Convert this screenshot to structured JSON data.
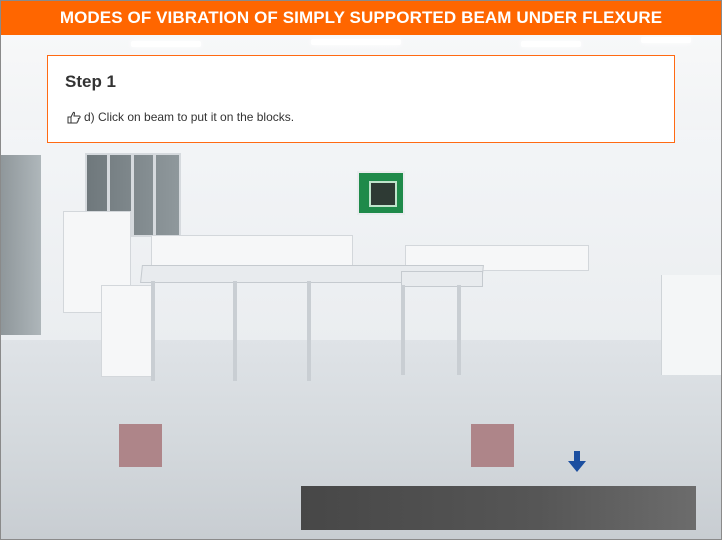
{
  "header": {
    "title": "MODES OF VIBRATION OF SIMPLY SUPPORTED BEAM UNDER FLEXURE"
  },
  "step_panel": {
    "step_label": "Step 1",
    "instruction_icon": "hand-pointing-icon",
    "instruction": "d) Click on beam to put it on the blocks."
  },
  "scene": {
    "background": "laboratory-room-photo",
    "support_blocks_color": "#ae8589",
    "arrow_icon": "arrow-down-icon",
    "arrow_color": "#1c4fa0",
    "beam_color": "#4a4a4a"
  },
  "colors": {
    "accent": "#ff6600",
    "panel_border": "#ff6a13"
  }
}
